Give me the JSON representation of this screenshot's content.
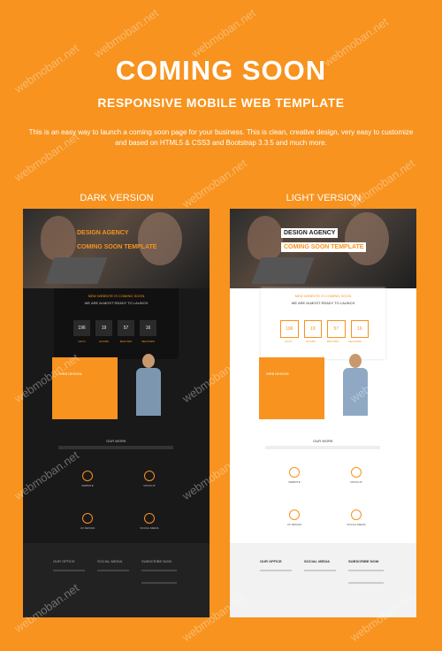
{
  "header": {
    "title": "COMING SOON",
    "subtitle": "RESPONSIVE MOBILE WEB TEMPLATE",
    "description": "This is an easy way to launch a coming soon page for your business. This is clean, creative design, very easy to customize and based on HTML5 & CSS3 and Bootstrap 3.3.5 and much more."
  },
  "versions": {
    "dark_label": "DARK VERSION",
    "light_label": "LIGHT VERSION"
  },
  "preview": {
    "tag_agency": "DESIGN AGENCY",
    "tag_template": "COMING SOON TEMPLATE",
    "panel_title": "NEW WEBSITE IS COMING SOON",
    "panel_sub": "WE ARE ALMOST READY TO LAUNCH",
    "countdown": [
      "196",
      "19",
      "57",
      "16"
    ],
    "countdown_labels": [
      "DAYS",
      "HOURS",
      "MINUTES",
      "SECONDS"
    ],
    "about_label": "WEB DESIGN",
    "work_title": "OUR WORK",
    "services": [
      "WEBSITE",
      "MOCKUP",
      "UX DESIGN",
      "SOCIAL MEDIA"
    ],
    "footer_cols": [
      "OUR OFFICE",
      "SOCIAL MEDIA",
      "SUBSCRIBE NOW"
    ]
  },
  "watermark": "webmoban.net",
  "colors": {
    "accent": "#f7931e",
    "dark_bg": "#191919",
    "light_bg": "#ffffff"
  }
}
